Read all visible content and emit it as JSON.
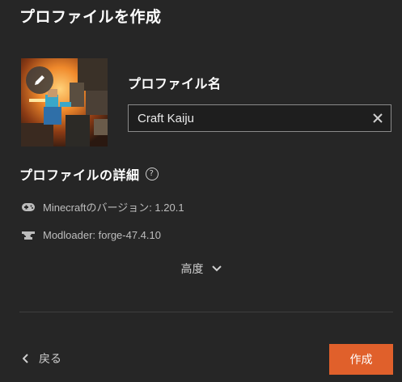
{
  "dialog": {
    "title": "プロファイルを作成",
    "profile_name_label": "プロファイル名",
    "profile_name_value": "Craft Kaiju",
    "details_title": "プロファイルの詳細",
    "help_glyph": "?",
    "version_text": "Minecraftのバージョン: 1.20.1",
    "modloader_text": "Modloader: forge-47.4.10",
    "advanced_label": "高度",
    "back_label": "戻る",
    "create_label": "作成"
  },
  "icons": {
    "edit": "pencil-icon",
    "clear": "close-icon",
    "help": "help-circle-icon",
    "version": "gamepad-icon",
    "modloader": "anvil-icon",
    "advanced": "chevron-down-icon",
    "back": "chevron-left-icon"
  },
  "colors": {
    "background": "#262626",
    "accent": "#e0602b",
    "input_border": "#8a8a8a",
    "muted_text": "#bdbdbd"
  }
}
